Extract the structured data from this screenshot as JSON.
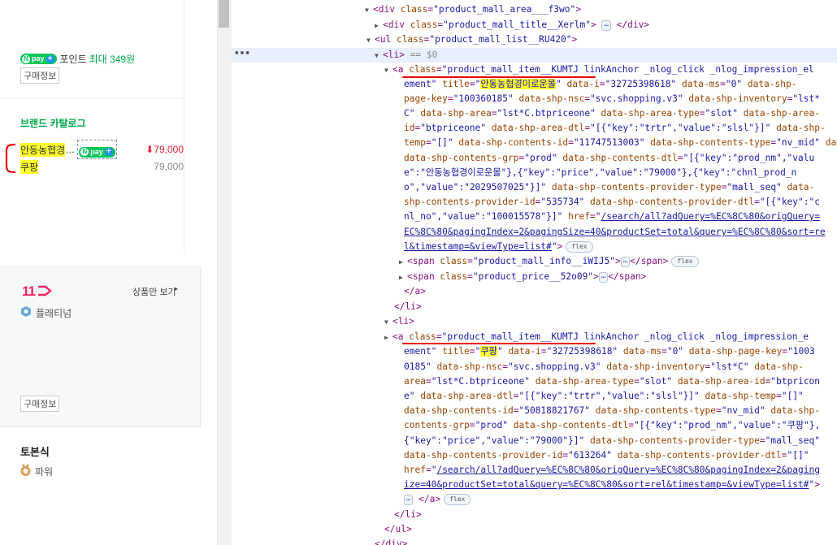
{
  "left_panel": {
    "point_prefix": "포인트",
    "point_amount": "최대 349원",
    "buy_info_1": "구매정보",
    "brand_catalog_title": "브랜드 카탈로그",
    "items": [
      {
        "name": "안동농협경",
        "price": "79,000",
        "price_marker": "⬇",
        "has_npay": true
      },
      {
        "name": "쿠팡",
        "price": "79,000"
      }
    ],
    "mall_logo": "11",
    "products_only": "상품만 보기",
    "grade": "플래티넘",
    "buy_info_2": "구매정보",
    "seller3": "토본식",
    "seller3_grade": "파워"
  },
  "npay": {
    "n": "N",
    "label": "pay",
    "plus": "+"
  },
  "devtools": {
    "lines": [
      {
        "tri": "▼",
        "p": [
          [
            "t",
            "<div "
          ],
          [
            "a",
            "class"
          ],
          [
            "t",
            "="
          ],
          [
            "v",
            "\"product_mall_area___f3wo\""
          ],
          [
            "t",
            ">"
          ]
        ]
      },
      {
        "tri": "▶",
        "p": [
          [
            "t",
            "<div "
          ],
          [
            "a",
            "class"
          ],
          [
            "t",
            "="
          ],
          [
            "v",
            "\"product_mall_title__Xerlm\""
          ],
          [
            "t",
            "> "
          ],
          [
            "e",
            "…"
          ],
          [
            "t",
            " </div>"
          ]
        ]
      },
      {
        "tri": "▼",
        "p": [
          [
            "t",
            "<ul "
          ],
          [
            "a",
            "class"
          ],
          [
            "t",
            "="
          ],
          [
            "v",
            "\"product_mall_list__RU420\""
          ],
          [
            "t",
            ">"
          ]
        ]
      },
      {
        "tri": "▼",
        "p": [
          [
            "t",
            "<li>"
          ],
          [
            "x",
            " == $0"
          ]
        ]
      },
      {
        "tri": "▼",
        "p": [
          [
            "t",
            "<a "
          ],
          [
            "a",
            "class"
          ],
          [
            "t",
            "="
          ],
          [
            "v",
            "\"product_mall_item__KUMTJ linkAnchor _nlog_click _nlog_impression_el"
          ]
        ]
      },
      {
        "p": [
          [
            "v",
            "ement\" "
          ],
          [
            "a",
            "title"
          ],
          [
            "t",
            "="
          ],
          [
            "v",
            "\""
          ],
          [
            "hv",
            "안동농협경이로운몰"
          ],
          [
            "v",
            "\""
          ],
          [
            "t",
            " "
          ],
          [
            "a",
            "data-i"
          ],
          [
            "t",
            "="
          ],
          [
            "v",
            "\"32725398618\""
          ],
          [
            "t",
            " "
          ],
          [
            "a",
            "data-ms"
          ],
          [
            "t",
            "="
          ],
          [
            "v",
            "\"0\""
          ],
          [
            "t",
            " "
          ],
          [
            "a",
            "data-shp-"
          ]
        ]
      },
      {
        "p": [
          [
            "a",
            "page-key"
          ],
          [
            "t",
            "="
          ],
          [
            "v",
            "\"100360185\""
          ],
          [
            "t",
            " "
          ],
          [
            "a",
            "data-shp-nsc"
          ],
          [
            "t",
            "="
          ],
          [
            "v",
            "\"svc.shopping.v3\""
          ],
          [
            "t",
            " "
          ],
          [
            "a",
            "data-shp-inventory"
          ],
          [
            "t",
            "="
          ],
          [
            "v",
            "\"lst*"
          ]
        ]
      },
      {
        "p": [
          [
            "v",
            "C\""
          ],
          [
            "t",
            " "
          ],
          [
            "a",
            "data-shp-area"
          ],
          [
            "t",
            "="
          ],
          [
            "v",
            "\"lst*C.btpriceone\""
          ],
          [
            "t",
            " "
          ],
          [
            "a",
            "data-shp-area-type"
          ],
          [
            "t",
            "="
          ],
          [
            "v",
            "\"slot\""
          ],
          [
            "t",
            " "
          ],
          [
            "a",
            "data-shp-area-"
          ]
        ]
      },
      {
        "p": [
          [
            "a",
            "id"
          ],
          [
            "t",
            "="
          ],
          [
            "v",
            "\"btpriceone\""
          ],
          [
            "t",
            " "
          ],
          [
            "a",
            "data-shp-area-dtl"
          ],
          [
            "t",
            "="
          ],
          [
            "v",
            "\"[{\"key\":\"trtr\",\"value\":\"slsl\"}]\""
          ],
          [
            "t",
            " "
          ],
          [
            "a",
            "data-shp-"
          ]
        ]
      },
      {
        "p": [
          [
            "a",
            "temp"
          ],
          [
            "t",
            "="
          ],
          [
            "v",
            "\"[]\""
          ],
          [
            "t",
            " "
          ],
          [
            "a",
            "data-shp-contents-id"
          ],
          [
            "t",
            "="
          ],
          [
            "v",
            "\"11747513003\""
          ],
          [
            "t",
            " "
          ],
          [
            "a",
            "data-shp-contents-type"
          ],
          [
            "t",
            "="
          ],
          [
            "v",
            "\"nv_mid\""
          ],
          [
            "t",
            " "
          ],
          [
            "a",
            "data-shp-"
          ]
        ]
      },
      {
        "p": [
          [
            "a",
            "data-shp-contents-grp"
          ],
          [
            "t",
            "="
          ],
          [
            "v",
            "\"prod\""
          ],
          [
            "t",
            " "
          ],
          [
            "a",
            "data-shp-contents-dtl"
          ],
          [
            "t",
            "="
          ],
          [
            "v",
            "\"[{\"key\":\"prod_nm\",\"valu"
          ]
        ]
      },
      {
        "p": [
          [
            "v",
            "e\":\"안동농협경이로운몰\"},{\"key\":\"price\",\"value\":\"79000\"},{\"key\":\"chnl_prod_n"
          ]
        ]
      },
      {
        "p": [
          [
            "v",
            "o\",\"value\":\"2029507025\"}]\""
          ],
          [
            "t",
            " "
          ],
          [
            "a",
            "data-shp-contents-provider-type"
          ],
          [
            "t",
            "="
          ],
          [
            "v",
            "\"mall_seq\""
          ],
          [
            "t",
            " "
          ],
          [
            "a",
            "data-"
          ]
        ]
      },
      {
        "p": [
          [
            "a",
            "shp-contents-provider-id"
          ],
          [
            "t",
            "="
          ],
          [
            "v",
            "\"535734\""
          ],
          [
            "t",
            " "
          ],
          [
            "a",
            "data-shp-contents-provider-dtl"
          ],
          [
            "t",
            "="
          ],
          [
            "v",
            "\"[{\"key\":\"c"
          ]
        ]
      },
      {
        "p": [
          [
            "v",
            "nl_no\",\"value\":\"100015578\"}]\""
          ],
          [
            "t",
            " "
          ],
          [
            "a",
            "href"
          ],
          [
            "t",
            "="
          ],
          [
            "v",
            "\""
          ],
          [
            "l",
            "/search/all?adQuery=%EC%8C%80&origQuery="
          ]
        ]
      },
      {
        "p": [
          [
            "l",
            "EC%8C%80&pagingIndex=2&pagingSize=40&productSet=total&query=%EC%8C%80&sort=re"
          ]
        ]
      },
      {
        "p": [
          [
            "l",
            "l&timestamp=&viewType=list#"
          ],
          [
            "v",
            "\""
          ],
          [
            "t",
            ">"
          ],
          [
            "f",
            "flex"
          ]
        ]
      },
      {
        "tri": "▶",
        "p": [
          [
            "t",
            "<span "
          ],
          [
            "a",
            "class"
          ],
          [
            "t",
            "="
          ],
          [
            "v",
            "\"product_mall_info__iWIJ5\""
          ],
          [
            "t",
            ">"
          ],
          [
            "e",
            "…"
          ],
          [
            "t",
            "</span>"
          ],
          [
            "f",
            "flex"
          ]
        ]
      },
      {
        "tri": "▶",
        "p": [
          [
            "t",
            "<span "
          ],
          [
            "a",
            "class"
          ],
          [
            "t",
            "="
          ],
          [
            "v",
            "\"product_price__52o09\""
          ],
          [
            "t",
            ">"
          ],
          [
            "e",
            "…"
          ],
          [
            "t",
            "</span>"
          ]
        ]
      },
      {
        "p": [
          [
            "t",
            "</a>"
          ]
        ]
      },
      {
        "p": [
          [
            "t",
            "</li>"
          ]
        ]
      },
      {
        "tri": "▼",
        "p": [
          [
            "t",
            "<li>"
          ]
        ]
      },
      {
        "tri": "▶",
        "p": [
          [
            "t",
            "<a "
          ],
          [
            "a",
            "class"
          ],
          [
            "t",
            "="
          ],
          [
            "v",
            "\"product_mall_item__KUMTJ linkAnchor _nlog_click _nlog_impression_e"
          ]
        ]
      },
      {
        "p": [
          [
            "v",
            "ement\" "
          ],
          [
            "a",
            "title"
          ],
          [
            "t",
            "="
          ],
          [
            "v",
            "\""
          ],
          [
            "hv",
            "쿠팡"
          ],
          [
            "v",
            "\""
          ],
          [
            "t",
            " "
          ],
          [
            "a",
            "data-i"
          ],
          [
            "t",
            "="
          ],
          [
            "v",
            "\"32725398618\""
          ],
          [
            "t",
            " "
          ],
          [
            "a",
            "data-ms"
          ],
          [
            "t",
            "="
          ],
          [
            "v",
            "\"0\""
          ],
          [
            "t",
            " "
          ],
          [
            "a",
            "data-shp-page-key"
          ],
          [
            "t",
            "="
          ],
          [
            "v",
            "\"1003"
          ]
        ]
      },
      {
        "p": [
          [
            "v",
            "0185\""
          ],
          [
            "t",
            " "
          ],
          [
            "a",
            "data-shp-nsc"
          ],
          [
            "t",
            "="
          ],
          [
            "v",
            "\"svc.shopping.v3\""
          ],
          [
            "t",
            " "
          ],
          [
            "a",
            "data-shp-inventory"
          ],
          [
            "t",
            "="
          ],
          [
            "v",
            "\"lst*C\""
          ],
          [
            "t",
            " "
          ],
          [
            "a",
            "data-shp-"
          ]
        ]
      },
      {
        "p": [
          [
            "a",
            "area"
          ],
          [
            "t",
            "="
          ],
          [
            "v",
            "\"lst*C.btpriceone\""
          ],
          [
            "t",
            " "
          ],
          [
            "a",
            "data-shp-area-type"
          ],
          [
            "t",
            "="
          ],
          [
            "v",
            "\"slot\""
          ],
          [
            "t",
            " "
          ],
          [
            "a",
            "data-shp-area-id"
          ],
          [
            "t",
            "="
          ],
          [
            "v",
            "\"btpricon"
          ]
        ]
      },
      {
        "p": [
          [
            "v",
            "e\""
          ],
          [
            "t",
            " "
          ],
          [
            "a",
            "data-shp-area-dtl"
          ],
          [
            "t",
            "="
          ],
          [
            "v",
            "\"[{\"key\":\"trtr\",\"value\":\"slsl\"}]\""
          ],
          [
            "t",
            " "
          ],
          [
            "a",
            "data-shp-temp"
          ],
          [
            "t",
            "="
          ],
          [
            "v",
            "\"[]\""
          ]
        ]
      },
      {
        "p": [
          [
            "a",
            "data-shp-contents-id"
          ],
          [
            "t",
            "="
          ],
          [
            "v",
            "\"50818821767\""
          ],
          [
            "t",
            " "
          ],
          [
            "a",
            "data-shp-contents-type"
          ],
          [
            "t",
            "="
          ],
          [
            "v",
            "\"nv_mid\""
          ],
          [
            "t",
            " "
          ],
          [
            "a",
            "data-shp-"
          ]
        ]
      },
      {
        "p": [
          [
            "a",
            "contents-grp"
          ],
          [
            "t",
            "="
          ],
          [
            "v",
            "\"prod\""
          ],
          [
            "t",
            " "
          ],
          [
            "a",
            "data-shp-contents-dtl"
          ],
          [
            "t",
            "="
          ],
          [
            "v",
            "\"[{\"key\":\"prod_nm\",\"value\":\"쿠팡\"},"
          ]
        ]
      },
      {
        "p": [
          [
            "v",
            "{\"key\":\"price\",\"value\":\"79000\"}]\""
          ],
          [
            "t",
            " "
          ],
          [
            "a",
            "data-shp-contents-provider-type"
          ],
          [
            "t",
            "="
          ],
          [
            "v",
            "\"mall_seq\""
          ]
        ]
      },
      {
        "p": [
          [
            "a",
            "data-shp-contents-provider-id"
          ],
          [
            "t",
            "="
          ],
          [
            "v",
            "\"613264\""
          ],
          [
            "t",
            " "
          ],
          [
            "a",
            "data-shp-contents-provider-dtl"
          ],
          [
            "t",
            "="
          ],
          [
            "v",
            "\"[]\""
          ]
        ]
      },
      {
        "p": [
          [
            "a",
            "href"
          ],
          [
            "t",
            "="
          ],
          [
            "v",
            "\""
          ],
          [
            "l",
            "/search/all?adQuery=%EC%8C%80&origQuery=%EC%8C%80&pagingIndex=2&paging"
          ]
        ]
      },
      {
        "p": [
          [
            "l",
            "ize=40&productSet=total&query=%EC%8C%80&sort=rel&timestamp=&viewType=list#"
          ],
          [
            "v",
            "\""
          ],
          [
            "t",
            ">"
          ]
        ]
      },
      {
        "p": [
          [
            "e",
            "…"
          ],
          [
            "t",
            " </a>"
          ],
          [
            "f",
            "flex"
          ]
        ]
      },
      {
        "p": [
          [
            "t",
            "</li>"
          ]
        ]
      },
      {
        "p": [
          [
            "t",
            "</ul>"
          ]
        ]
      },
      {
        "p": [
          [
            "t",
            "</div>"
          ]
        ]
      }
    ]
  }
}
